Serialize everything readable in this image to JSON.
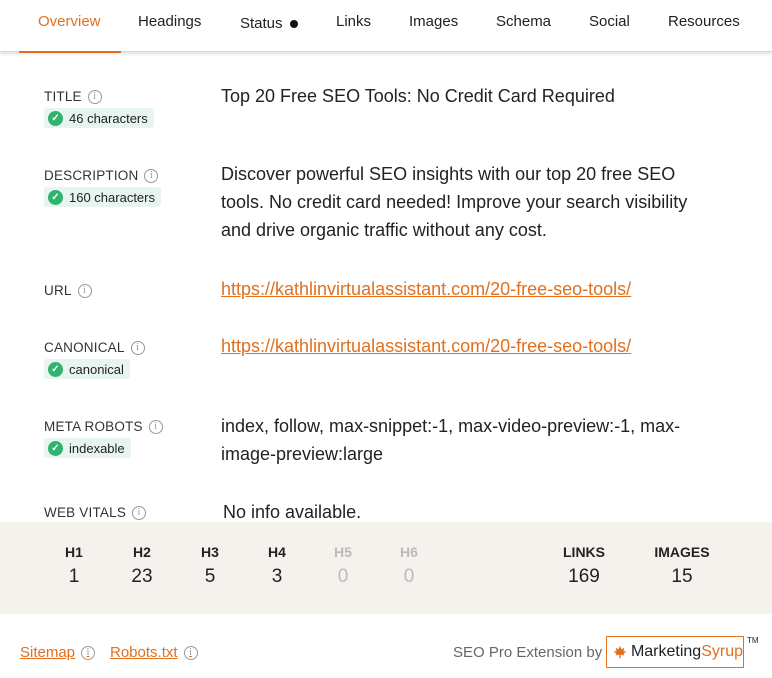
{
  "tabs": [
    {
      "label": "Overview",
      "active": true
    },
    {
      "label": "Headings"
    },
    {
      "label": "Status"
    },
    {
      "label": "Links"
    },
    {
      "label": "Images"
    },
    {
      "label": "Schema"
    },
    {
      "label": "Social"
    },
    {
      "label": "Resources"
    }
  ],
  "info_icon": "i",
  "check_icon": "✓",
  "fields": {
    "title": {
      "label": "TITLE",
      "badge": "46 characters",
      "value": "Top 20 Free SEO Tools: No Credit Card Required"
    },
    "description": {
      "label": "DESCRIPTION",
      "badge": "160 characters",
      "value": "Discover powerful SEO insights with our top 20 free SEO tools. No credit card needed! Improve your search visibility and drive organic traffic without any cost."
    },
    "url": {
      "label": "URL",
      "value": "https://kathlinvirtualassistant.com/20-free-seo-tools/"
    },
    "canonical": {
      "label": "CANONICAL",
      "badge": "canonical",
      "value": "https://kathlinvirtualassistant.com/20-free-seo-tools/"
    },
    "meta_robots": {
      "label": "META ROBOTS",
      "badge": "indexable",
      "value": "index, follow, max-snippet:-1, max-video-preview:-1, max-image-preview:large"
    },
    "web_vitals": {
      "label": "WEB VITALS",
      "value": "No info available."
    }
  },
  "stats": {
    "h1": {
      "label": "H1",
      "value": "1"
    },
    "h2": {
      "label": "H2",
      "value": "23"
    },
    "h3": {
      "label": "H3",
      "value": "5"
    },
    "h4": {
      "label": "H4",
      "value": "3"
    },
    "h5": {
      "label": "H5",
      "value": "0"
    },
    "h6": {
      "label": "H6",
      "value": "0"
    },
    "links": {
      "label": "LINKS",
      "value": "169"
    },
    "images": {
      "label": "IMAGES",
      "value": "15"
    }
  },
  "footer": {
    "sitemap": "Sitemap",
    "robots": "Robots.txt",
    "credit": "SEO Pro Extension by",
    "brand_a": "Marketing",
    "brand_b": "Syrup",
    "tm": "TM"
  },
  "colors": {
    "accent": "#e0701f",
    "check": "#2fb36f",
    "panel": "#f5f1ec"
  }
}
